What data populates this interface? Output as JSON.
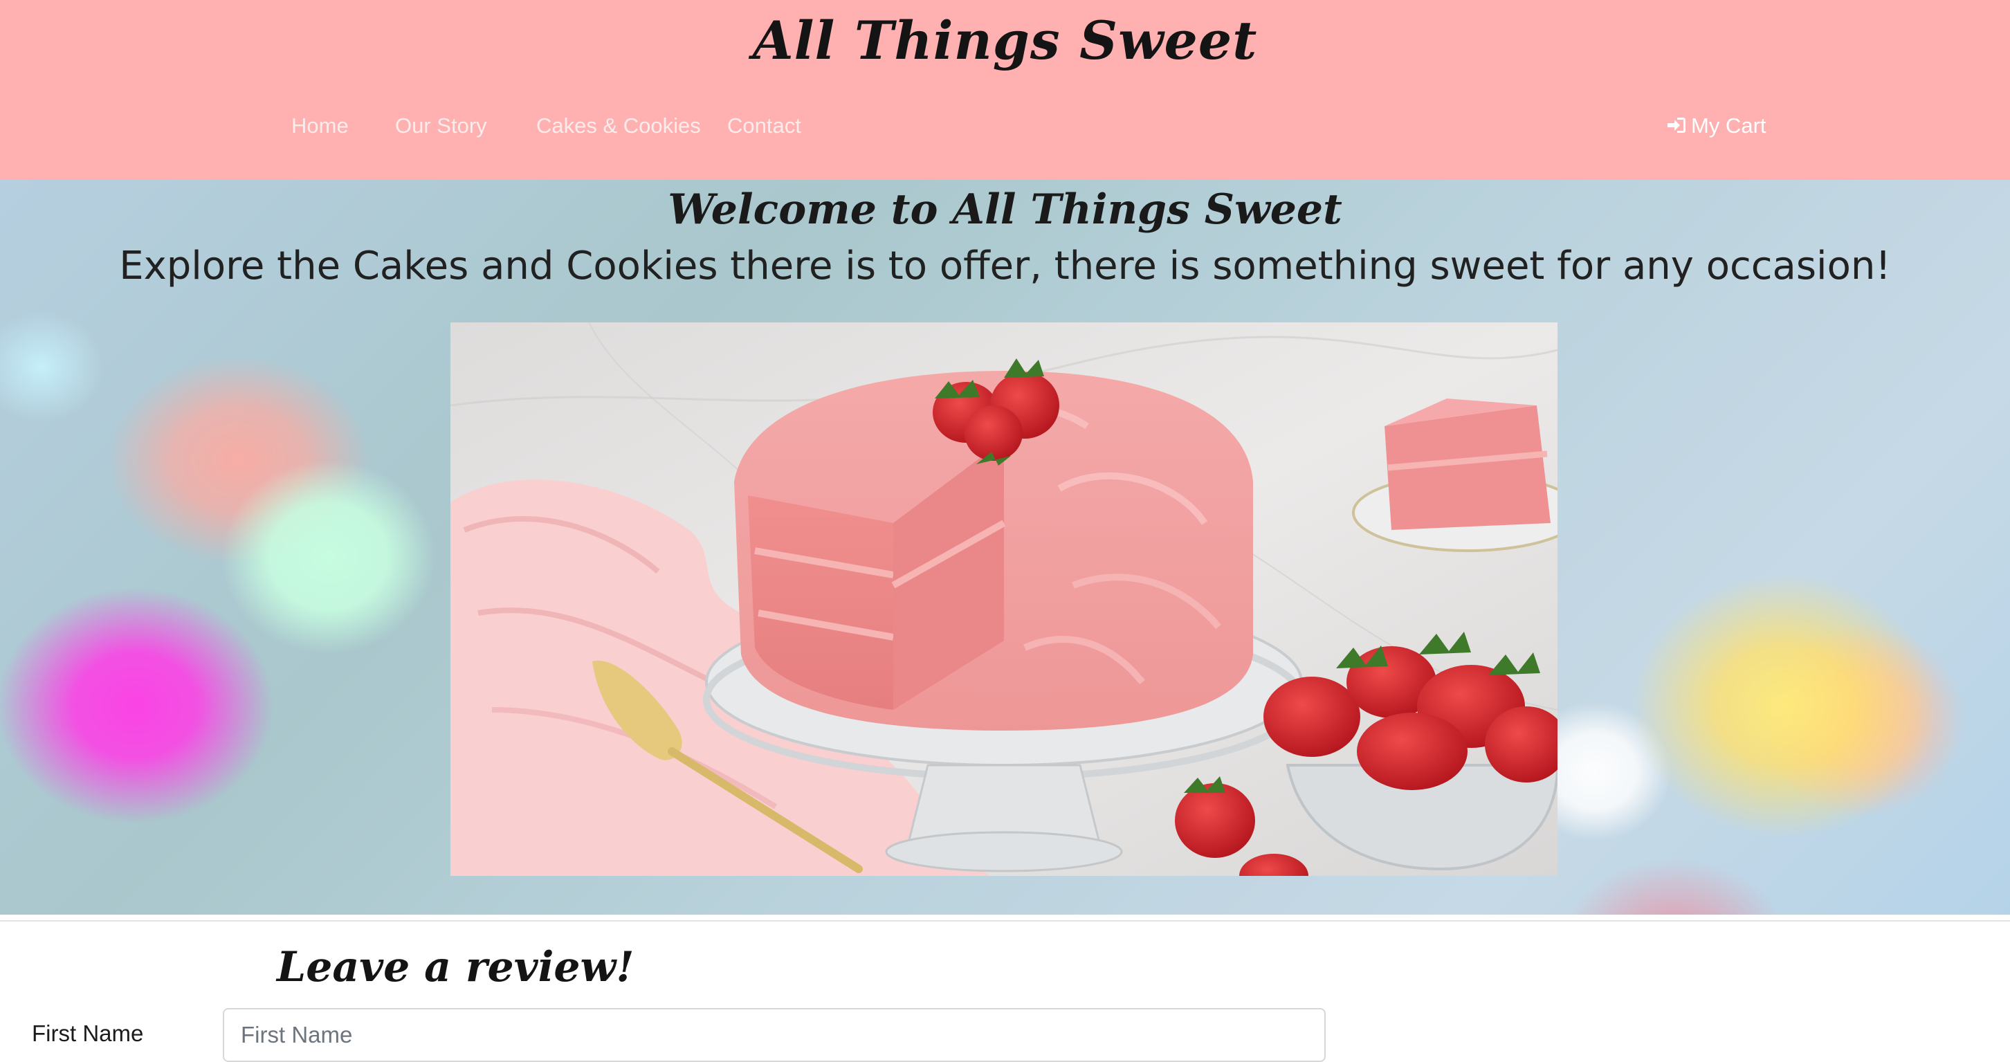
{
  "header": {
    "brand": "All Things Sweet",
    "nav": [
      {
        "label": "Home"
      },
      {
        "label": "Our Story"
      },
      {
        "label": "Cakes & Cookies"
      },
      {
        "label": "Contact"
      }
    ],
    "cart_label": "My Cart",
    "cart_icon": "sign-in-icon",
    "background": "#ffb0b0"
  },
  "hero": {
    "title": "Welcome to All Things Sweet",
    "subtitle": "Explore the Cakes and Cookies there is to offer, there is something sweet for any occasion!"
  },
  "review": {
    "title": "Leave a review!",
    "first_name_label": "First Name",
    "first_name_placeholder": "First Name",
    "first_name_value": ""
  }
}
